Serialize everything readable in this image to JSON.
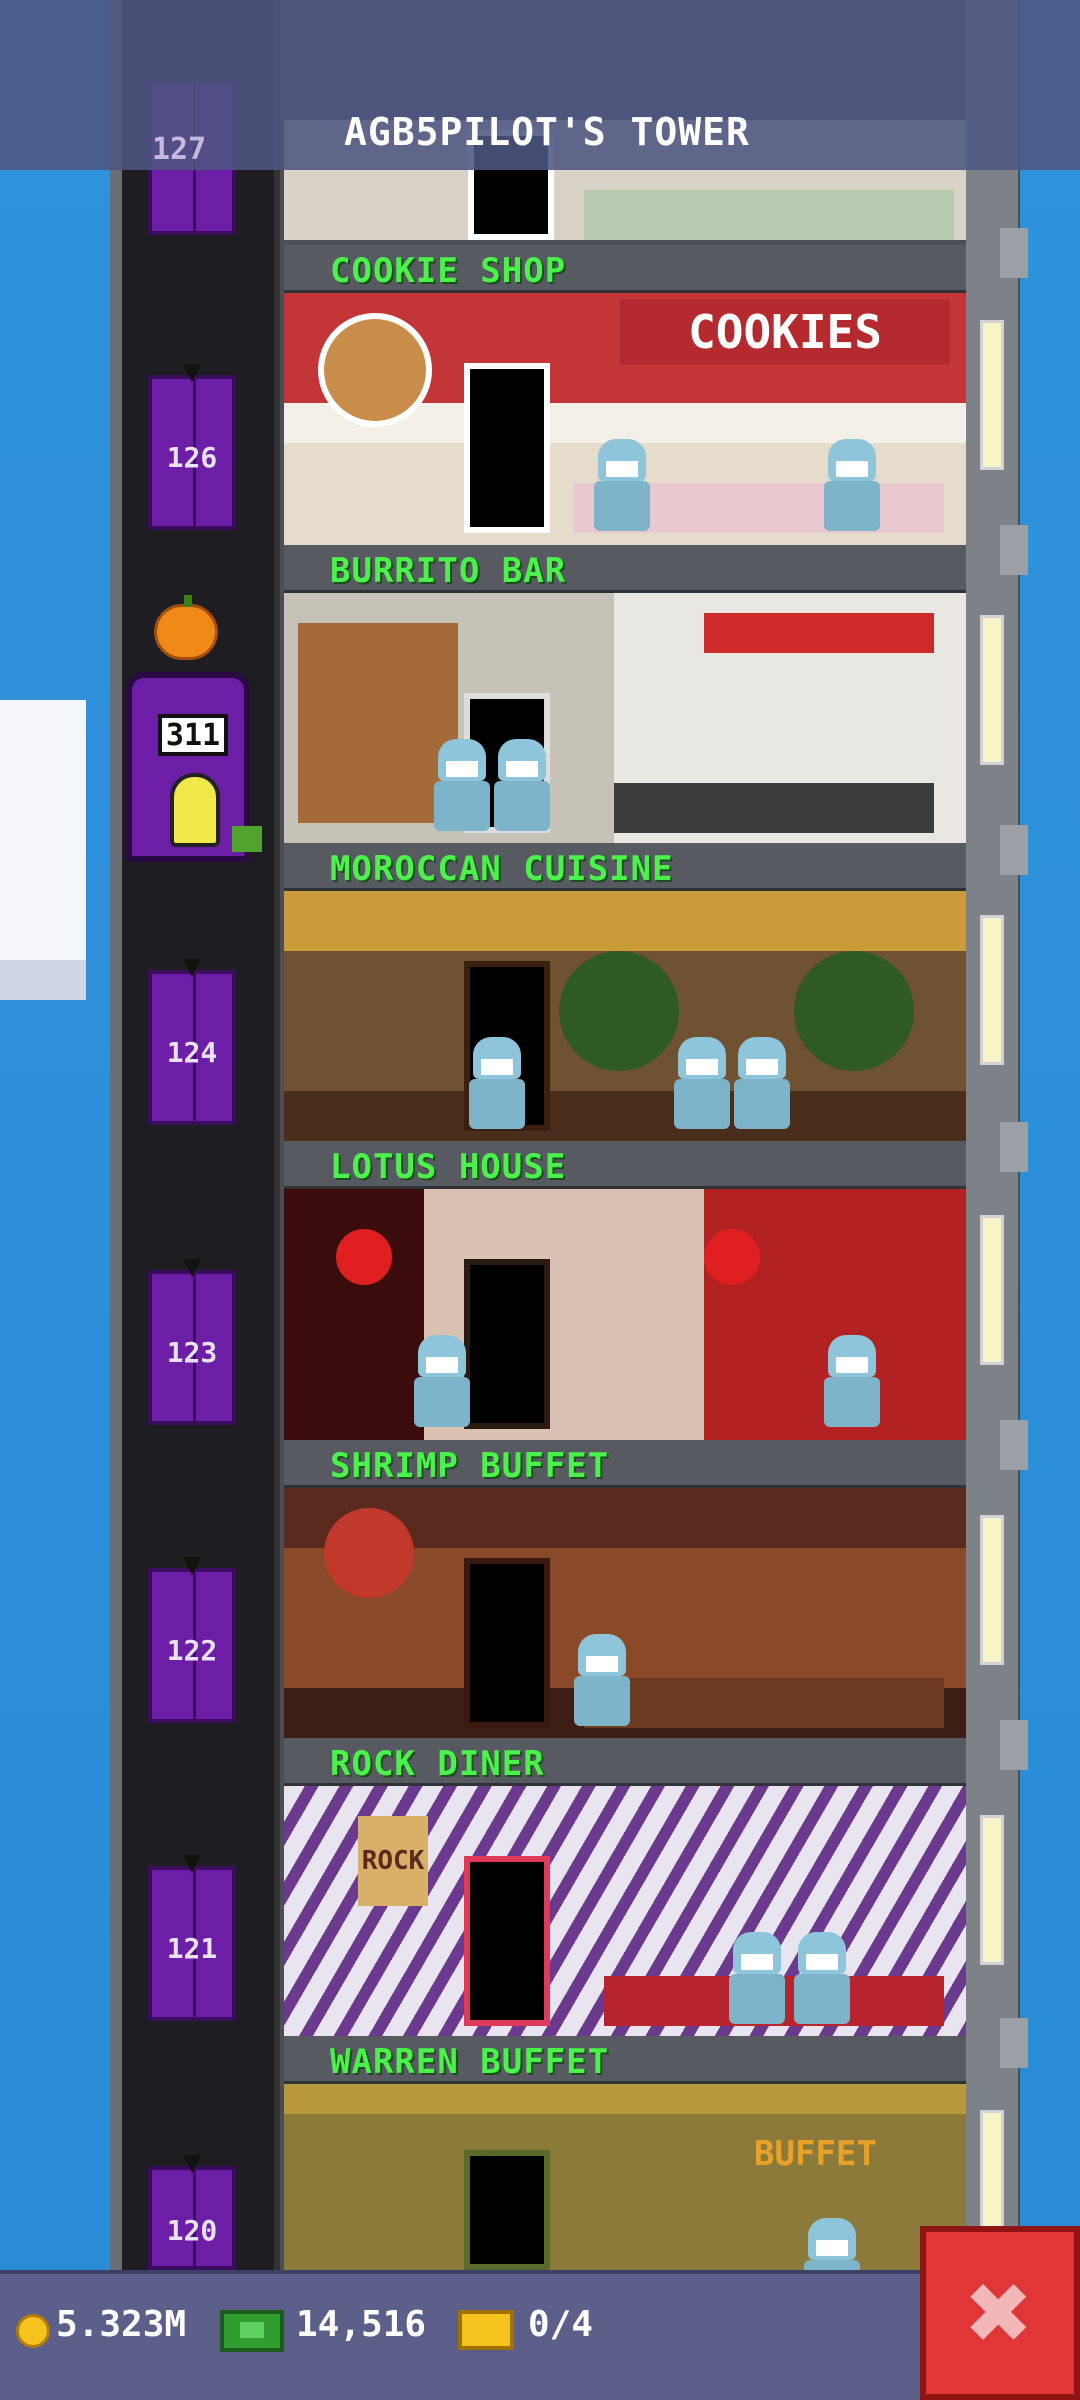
{
  "header": {
    "title": "AGB5PILOT'S TOWER",
    "partial_floor_number": "127"
  },
  "elevator": {
    "current_floor": "311",
    "floor_numbers": [
      "126",
      "124",
      "123",
      "122",
      "121",
      "120"
    ]
  },
  "floors": [
    {
      "name": "COOKIE SHOP",
      "sign": "COOKIES"
    },
    {
      "name": "BURRITO BAR"
    },
    {
      "name": "MOROCCAN CUISINE"
    },
    {
      "name": "LOTUS HOUSE"
    },
    {
      "name": "SHRIMP BUFFET"
    },
    {
      "name": "ROCK DINER",
      "sign": "ROCK"
    },
    {
      "name": "WARREN BUFFET",
      "sign": "BUFFET"
    }
  ],
  "status_bar": {
    "coins": "5.323M",
    "bux": "14,516",
    "tickets": "0/4"
  },
  "icons": [
    "coin-icon",
    "cash-icon",
    "ticket-icon",
    "close-icon",
    "pumpkin-icon",
    "bat-icon"
  ],
  "colors": {
    "label_green": "#4cf24c",
    "elevator_purple": "#6d1ea6",
    "close_red": "#e03636"
  }
}
